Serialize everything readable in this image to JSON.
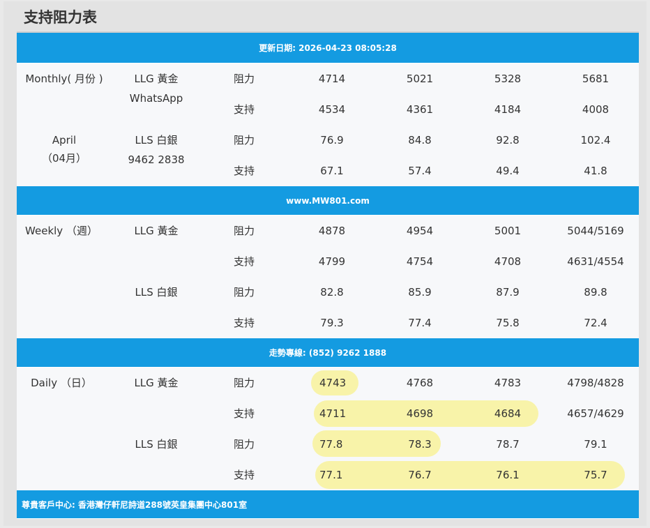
{
  "page_title": "支持阻力表",
  "updated_bar": "更新日期: 2026-04-23 08:05:28",
  "website_bar": "www.MW801.com",
  "hotline_bar": "走勢專線: (852) 9262 1888",
  "address_bar": "尊貴客戶中心: 香港灣仔軒尼詩道288號英皇集團中心801室",
  "labels": {
    "resistance": "阻力",
    "support": "支持"
  },
  "monthly": {
    "period_line1": "Monthly( 月份 )",
    "period_line2": "April",
    "period_line3": "（04月）",
    "gold_name": "LLG 黃金",
    "gold_extra": "WhatsApp",
    "silver_name": "LLS 白銀",
    "silver_extra": "9462 2838",
    "gold_resistance": [
      "4714",
      "5021",
      "5328",
      "5681"
    ],
    "gold_support": [
      "4534",
      "4361",
      "4184",
      "4008"
    ],
    "silver_resistance": [
      "76.9",
      "84.8",
      "92.8",
      "102.4"
    ],
    "silver_support": [
      "67.1",
      "57.4",
      "49.4",
      "41.8"
    ]
  },
  "weekly": {
    "period": "Weekly （週）",
    "gold_name": "LLG 黃金",
    "silver_name": "LLS 白銀",
    "gold_resistance": [
      "4878",
      "4954",
      "5001",
      "5044/5169"
    ],
    "gold_support": [
      "4799",
      "4754",
      "4708",
      "4631/4554"
    ],
    "silver_resistance": [
      "82.8",
      "85.9",
      "87.9",
      "89.8"
    ],
    "silver_support": [
      "79.3",
      "77.4",
      "75.8",
      "72.4"
    ]
  },
  "daily": {
    "period": "Daily （日）",
    "gold_name": "LLG 黃金",
    "silver_name": "LLS 白銀",
    "gold_resistance": [
      "4743",
      "4768",
      "4783",
      "4798/4828"
    ],
    "gold_support": [
      "4711",
      "4698",
      "4684",
      "4657/4629"
    ],
    "silver_resistance": [
      "77.8",
      "78.3",
      "78.7",
      "79.1"
    ],
    "silver_support": [
      "77.1",
      "76.7",
      "76.1",
      "75.7"
    ]
  },
  "colors": {
    "header_blue": "#149be1",
    "highlight_yellow": "#f7f2a0",
    "text": "#333333"
  }
}
